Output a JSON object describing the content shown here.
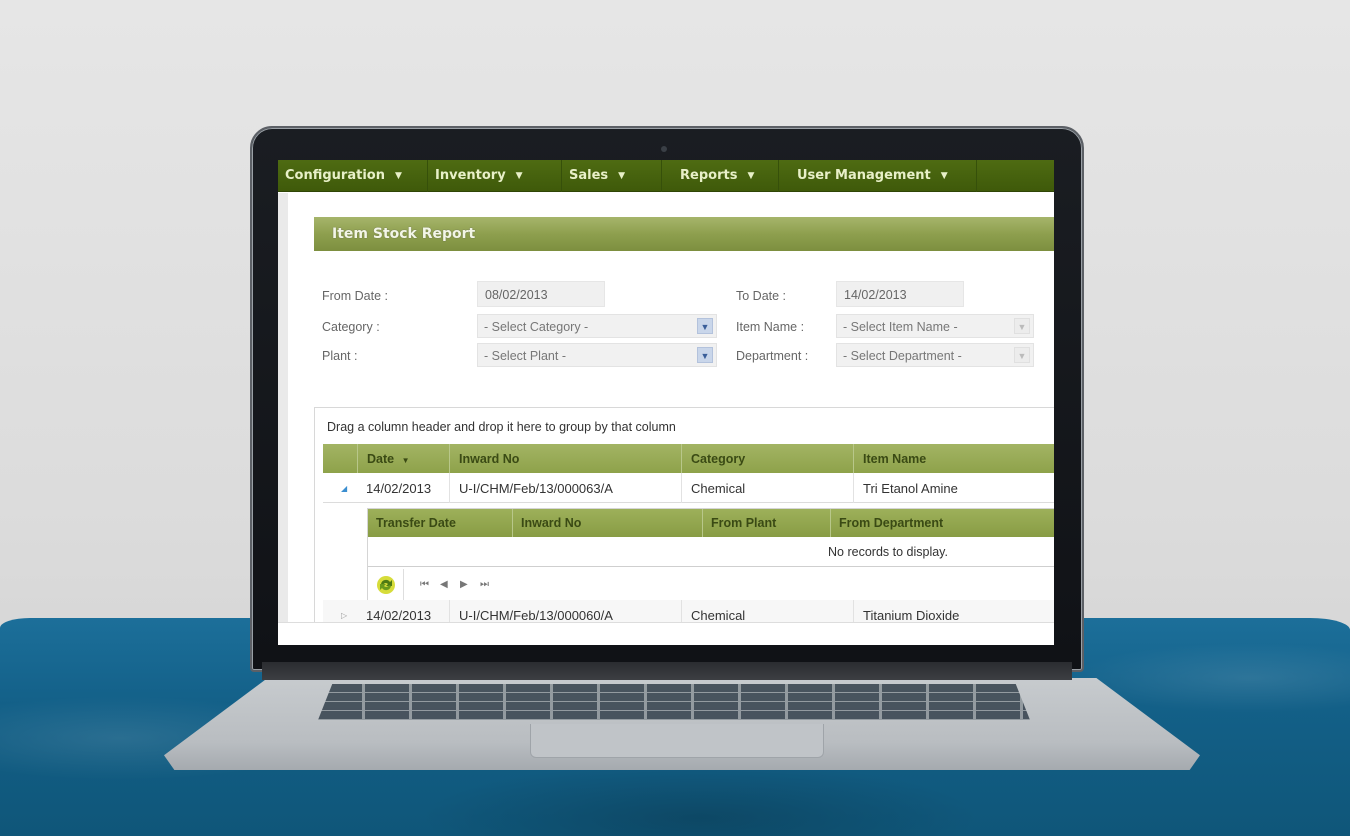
{
  "menu": {
    "items": [
      {
        "label": "Configuration"
      },
      {
        "label": "Inventory"
      },
      {
        "label": "Sales"
      },
      {
        "label": "Reports"
      },
      {
        "label": "User Management"
      }
    ],
    "caret": "▼"
  },
  "report": {
    "title": "Item Stock Report"
  },
  "filters": {
    "from_date": {
      "label": "From Date :",
      "value": "08/02/2013"
    },
    "to_date": {
      "label": "To Date :",
      "value": "14/02/2013"
    },
    "category": {
      "label": "Category :",
      "selected": "- Select Category -"
    },
    "item_name": {
      "label": "Item Name :",
      "selected": "- Select Item Name -"
    },
    "plant": {
      "label": "Plant :",
      "selected": "- Select Plant -"
    },
    "department": {
      "label": "Department :",
      "selected": "- Select Department -"
    }
  },
  "grid": {
    "group_hint": "Drag a column header and drop it here to group by that column",
    "columns": [
      "Date",
      "Inward No",
      "Category",
      "Item Name"
    ],
    "sort_indicator": "▼",
    "rows": [
      {
        "date": "14/02/2013",
        "inward_no": "U-I/CHM/Feb/13/000063/A",
        "category": "Chemical",
        "item_name": "Tri Etanol Amine",
        "expanded": true
      },
      {
        "date": "14/02/2013",
        "inward_no": "U-I/CHM/Feb/13/000060/A",
        "category": "Chemical",
        "item_name": "Titanium Dioxide",
        "expanded": false
      }
    ],
    "detail": {
      "columns": [
        "Transfer Date",
        "Inward No",
        "From Plant",
        "From Department"
      ],
      "empty_message": "No records to display."
    },
    "pager": {
      "first": "⏮",
      "prev": "◀",
      "next": "▶",
      "last": "⏭"
    }
  },
  "colors": {
    "menubar": "#4a6510",
    "header_green": "#8ea24a",
    "accent_blue": "#3b8ed0"
  }
}
